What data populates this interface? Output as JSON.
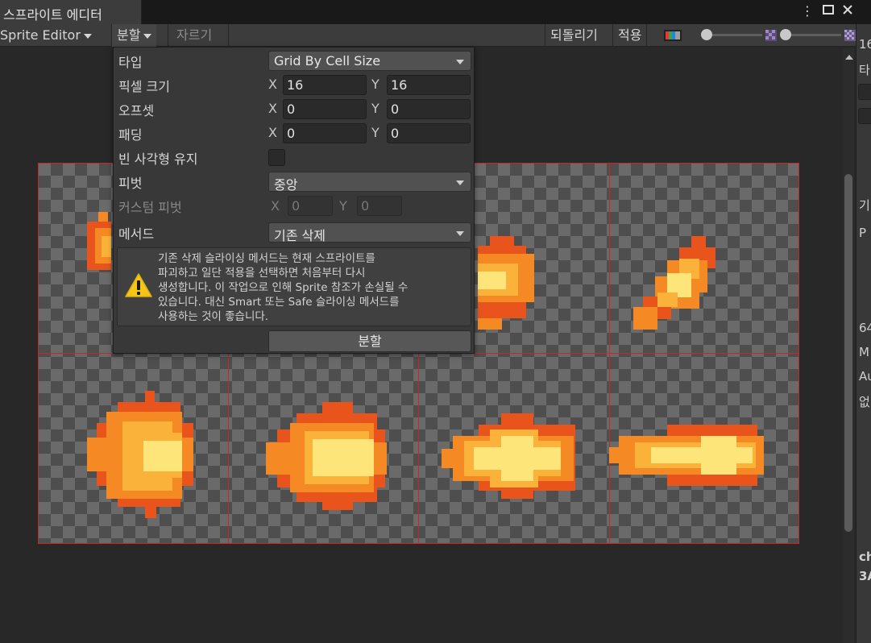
{
  "window": {
    "tab_title": "스프라이트 에디터",
    "menu_icon": "kebab-menu-icon",
    "maximize_icon": "maximize-icon",
    "close_icon": "close-icon"
  },
  "toolbar": {
    "mode_dropdown": "Sprite Editor",
    "slice_menu": "분할",
    "trim_button": "자르기",
    "revert_button": "되돌리기",
    "apply_button": "적용",
    "color_channel_icon": "rgb-channel-icon",
    "zoom_icon": "zoom-checker-icon",
    "mip_icon": "mip-checker-icon"
  },
  "slice_popup": {
    "type_label": "타입",
    "type_value": "Grid By Cell Size",
    "pixel_size_label": "픽셀 크기",
    "pixel_size": {
      "x_label": "X",
      "x": "16",
      "y_label": "Y",
      "y": "16"
    },
    "offset_label": "오프셋",
    "offset": {
      "x_label": "X",
      "x": "0",
      "y_label": "Y",
      "y": "0"
    },
    "padding_label": "패딩",
    "padding": {
      "x_label": "X",
      "x": "0",
      "y_label": "Y",
      "y": "0"
    },
    "keep_empty_label": "빈 사각형 유지",
    "keep_empty_checked": false,
    "pivot_label": "피벗",
    "pivot_value": "중앙",
    "custom_pivot_label": "커스텀 피벗",
    "custom_pivot": {
      "x_label": "X",
      "x": "0",
      "y_label": "Y",
      "y": "0"
    },
    "method_label": "메서드",
    "method_value": "기존 삭제",
    "warning_icon": "warning-icon",
    "warning_lines": [
      "기존 삭제 슬라이싱 메서드는 현재 스프라이트를",
      "파괴하고 일단 적용을 선택하면 처음부터 다시",
      "생성합니다. 이 작업으로 인해 Sprite 참조가 손실될 수",
      "있습니다. 대신 Smart 또는 Safe 슬라이싱 메서드를",
      "사용하는 것이 좋습니다."
    ],
    "slice_button": "분할"
  },
  "sprite_sheet": {
    "columns": 4,
    "rows": 2,
    "grid_color": "#c62828",
    "flame_colors": {
      "dark": "#e8541c",
      "mid": "#f58a24",
      "light": "#fbb23a",
      "core": "#fde57a"
    }
  },
  "inspector_clipped": [
    "16",
    "타",
    "기",
    "P",
    "64",
    "M",
    "Au",
    "없",
    "ch",
    "3A"
  ]
}
